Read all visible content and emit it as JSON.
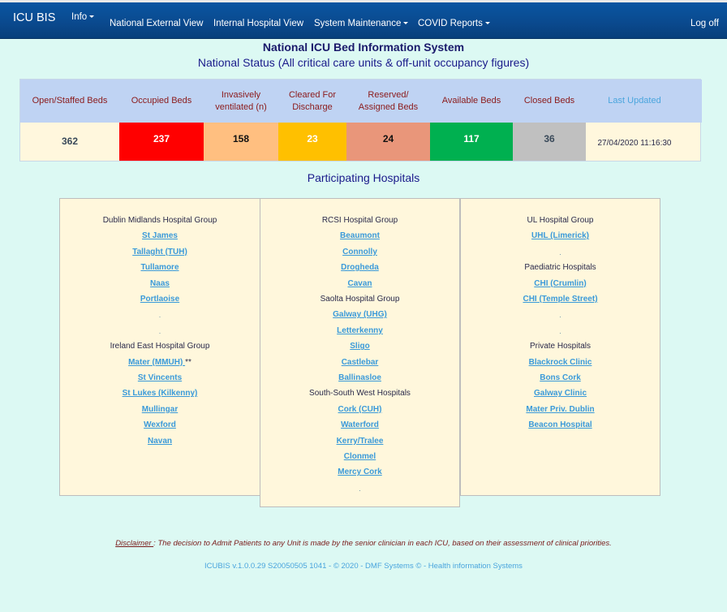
{
  "navbar": {
    "brand": "ICU BIS",
    "items": [
      {
        "label": "Info",
        "dropdown": true
      },
      {
        "label": "National External View",
        "dropdown": false
      },
      {
        "label": "Internal Hospital View",
        "dropdown": false
      },
      {
        "label": "System Maintenance",
        "dropdown": true
      },
      {
        "label": "COVID Reports",
        "dropdown": true
      }
    ],
    "logoff": "Log off"
  },
  "header": {
    "title": "National ICU Bed Information System",
    "subtitle": "National Status (All critical care units & off-unit occupancy figures)"
  },
  "status": {
    "columns": [
      {
        "label": "Open/Staffed Beds",
        "value": "362",
        "color": "#fff7dd",
        "text_color": "#3a4a5a"
      },
      {
        "label": "Occupied Beds",
        "value": "237",
        "color": "#ff0000",
        "text_color": "#ffffff"
      },
      {
        "label": "Invasively ventilated (n)",
        "value": "158",
        "color": "#ffbf80",
        "text_color": "#111111"
      },
      {
        "label": "Cleared For Discharge",
        "value": "23",
        "color": "#ffc000",
        "text_color": "#ffffff"
      },
      {
        "label": "Reserved/ Assigned Beds",
        "value": "24",
        "color": "#e9967a",
        "text_color": "#111111"
      },
      {
        "label": "Available Beds",
        "value": "117",
        "color": "#00b050",
        "text_color": "#ffffff"
      },
      {
        "label": "Closed Beds",
        "value": "36",
        "color": "#c0c0c0",
        "text_color": "#3a4a5a"
      }
    ],
    "last_updated_label": "Last Updated",
    "last_updated_value": "27/04/2020 11:16:30"
  },
  "hospitals": {
    "title": "Participating Hospitals",
    "columns": [
      {
        "entries": [
          {
            "type": "group",
            "text": "Dublin Midlands Hospital Group"
          },
          {
            "type": "link",
            "text": "St James"
          },
          {
            "type": "link",
            "text": "Tallaght (TUH)"
          },
          {
            "type": "link",
            "text": "Tullamore"
          },
          {
            "type": "link",
            "text": "Naas"
          },
          {
            "type": "link",
            "text": "Portlaoise"
          },
          {
            "type": "dot",
            "text": "."
          },
          {
            "type": "dot",
            "text": "."
          },
          {
            "type": "group",
            "text": "Ireland East Hospital Group"
          },
          {
            "type": "link",
            "text": "Mater (MMUH) ",
            "suffix": "**"
          },
          {
            "type": "link",
            "text": "St Vincents"
          },
          {
            "type": "link",
            "text": "St Lukes (Kilkenny)"
          },
          {
            "type": "link",
            "text": "Mullingar"
          },
          {
            "type": "link",
            "text": "Wexford"
          },
          {
            "type": "link",
            "text": "Navan"
          }
        ]
      },
      {
        "entries": [
          {
            "type": "group",
            "text": "RCSI Hospital Group"
          },
          {
            "type": "link",
            "text": "Beaumont"
          },
          {
            "type": "link",
            "text": "Connolly"
          },
          {
            "type": "link",
            "text": "Drogheda"
          },
          {
            "type": "link",
            "text": "Cavan"
          },
          {
            "type": "group",
            "text": "Saolta Hospital Group"
          },
          {
            "type": "link",
            "text": "Galway (UHG)"
          },
          {
            "type": "link",
            "text": "Letterkenny"
          },
          {
            "type": "link",
            "text": "Sligo"
          },
          {
            "type": "link",
            "text": "Castlebar"
          },
          {
            "type": "link",
            "text": "Ballinasloe"
          },
          {
            "type": "group",
            "text": "South-South West Hospitals"
          },
          {
            "type": "link",
            "text": "Cork (CUH)"
          },
          {
            "type": "link",
            "text": "Waterford"
          },
          {
            "type": "link",
            "text": "Kerry/Tralee"
          },
          {
            "type": "link",
            "text": "Clonmel"
          },
          {
            "type": "link",
            "text": "Mercy Cork"
          },
          {
            "type": "dot",
            "text": "."
          }
        ]
      },
      {
        "entries": [
          {
            "type": "group",
            "text": "UL Hospital Group"
          },
          {
            "type": "link",
            "text": "UHL (Limerick)"
          },
          {
            "type": "dot",
            "text": "."
          },
          {
            "type": "group",
            "text": "Paediatric Hospitals"
          },
          {
            "type": "link",
            "text": "CHI (Crumlin)"
          },
          {
            "type": "link",
            "text": "CHI (Temple Street)"
          },
          {
            "type": "dot",
            "text": "."
          },
          {
            "type": "dot",
            "text": "."
          },
          {
            "type": "group",
            "text": "Private Hospitals"
          },
          {
            "type": "link",
            "text": "Blackrock Clinic"
          },
          {
            "type": "link",
            "text": "Bons Cork"
          },
          {
            "type": "link",
            "text": "Galway Clinic"
          },
          {
            "type": "link",
            "text": "Mater Priv. Dublin"
          },
          {
            "type": "link",
            "text": "Beacon Hospital"
          }
        ]
      }
    ]
  },
  "disclaimer": {
    "label": "Disclaimer ",
    "text": ": The decision to Admit Patients to any Unit is made by the senior clinician in each ICU, based on their assessment of clinical priorities."
  },
  "footer": {
    "text": "ICUBIS v.1.0.0.29  S20050505 1041 - © 2020 - DMF Systems © - Health information Systems"
  }
}
